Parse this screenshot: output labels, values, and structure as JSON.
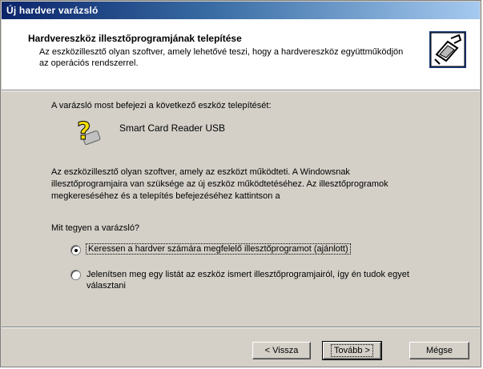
{
  "window": {
    "title": "Új hardver varázsló"
  },
  "header": {
    "title": "Hardvereszköz illesztőprogramjának telepítése",
    "description": "Az eszközillesztő olyan szoftver, amely lehetővé teszi, hogy a hardvereszköz együttműködjön az operációs rendszerrel."
  },
  "content": {
    "intro": "A varázsló most befejezi a következő eszköz telepítését:",
    "device_name": "Smart Card Reader USB",
    "info": "Az eszközillesztő olyan szoftver, amely az eszközt működteti. A Windowsnak illesztőprogramjaira van szüksége az új eszköz működtetéséhez. Az illesztőprogramok megkereséséhez és a telepítés befejezéséhez kattintson a",
    "question": "Mit tegyen a varázsló?",
    "options": [
      {
        "label": "Keressen a hardver számára megfelelő illesztőprogramot (ajánlott)",
        "selected": true
      },
      {
        "label": "Jelenítsen meg egy listát az eszköz ismert illesztőprogramjairól, így én tudok egyet választani",
        "selected": false
      }
    ]
  },
  "buttons": {
    "back": "< Vissza",
    "next": "Tovább >",
    "cancel": "Mégse"
  }
}
